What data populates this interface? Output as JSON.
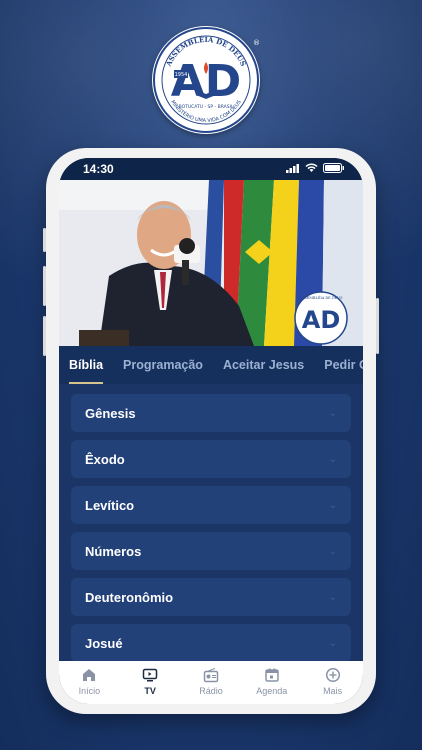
{
  "logo": {
    "top_text": "ASSEMBLÉIA DE DEUS",
    "letters": "AD",
    "year": "1954",
    "city": "BOTUCATU - SP - BRASIL",
    "motto": "MINISTÉRIO UMA VIDA COM DEUS",
    "reg": "®"
  },
  "status": {
    "time": "14:30"
  },
  "hero": {
    "badge_letters": "AD",
    "badge_top": "ASSEMBLÉIA DE DEUS"
  },
  "tabs": [
    {
      "label": "Bíblia"
    },
    {
      "label": "Programação"
    },
    {
      "label": "Aceitar Jesus"
    },
    {
      "label": "Pedir Or"
    }
  ],
  "books": [
    {
      "label": "Gênesis"
    },
    {
      "label": "Êxodo"
    },
    {
      "label": "Levítico"
    },
    {
      "label": "Números"
    },
    {
      "label": "Deuteronômio"
    },
    {
      "label": "Josué"
    }
  ],
  "tabbar": [
    {
      "label": "Início",
      "icon": "home-icon"
    },
    {
      "label": "TV",
      "icon": "tv-icon"
    },
    {
      "label": "Rádio",
      "icon": "radio-icon"
    },
    {
      "label": "Agenda",
      "icon": "calendar-icon"
    },
    {
      "label": "Mais",
      "icon": "plus-circle-icon"
    }
  ],
  "colors": {
    "background": "#1c3a70",
    "accent": "#d7c38d",
    "card": "#234179"
  }
}
